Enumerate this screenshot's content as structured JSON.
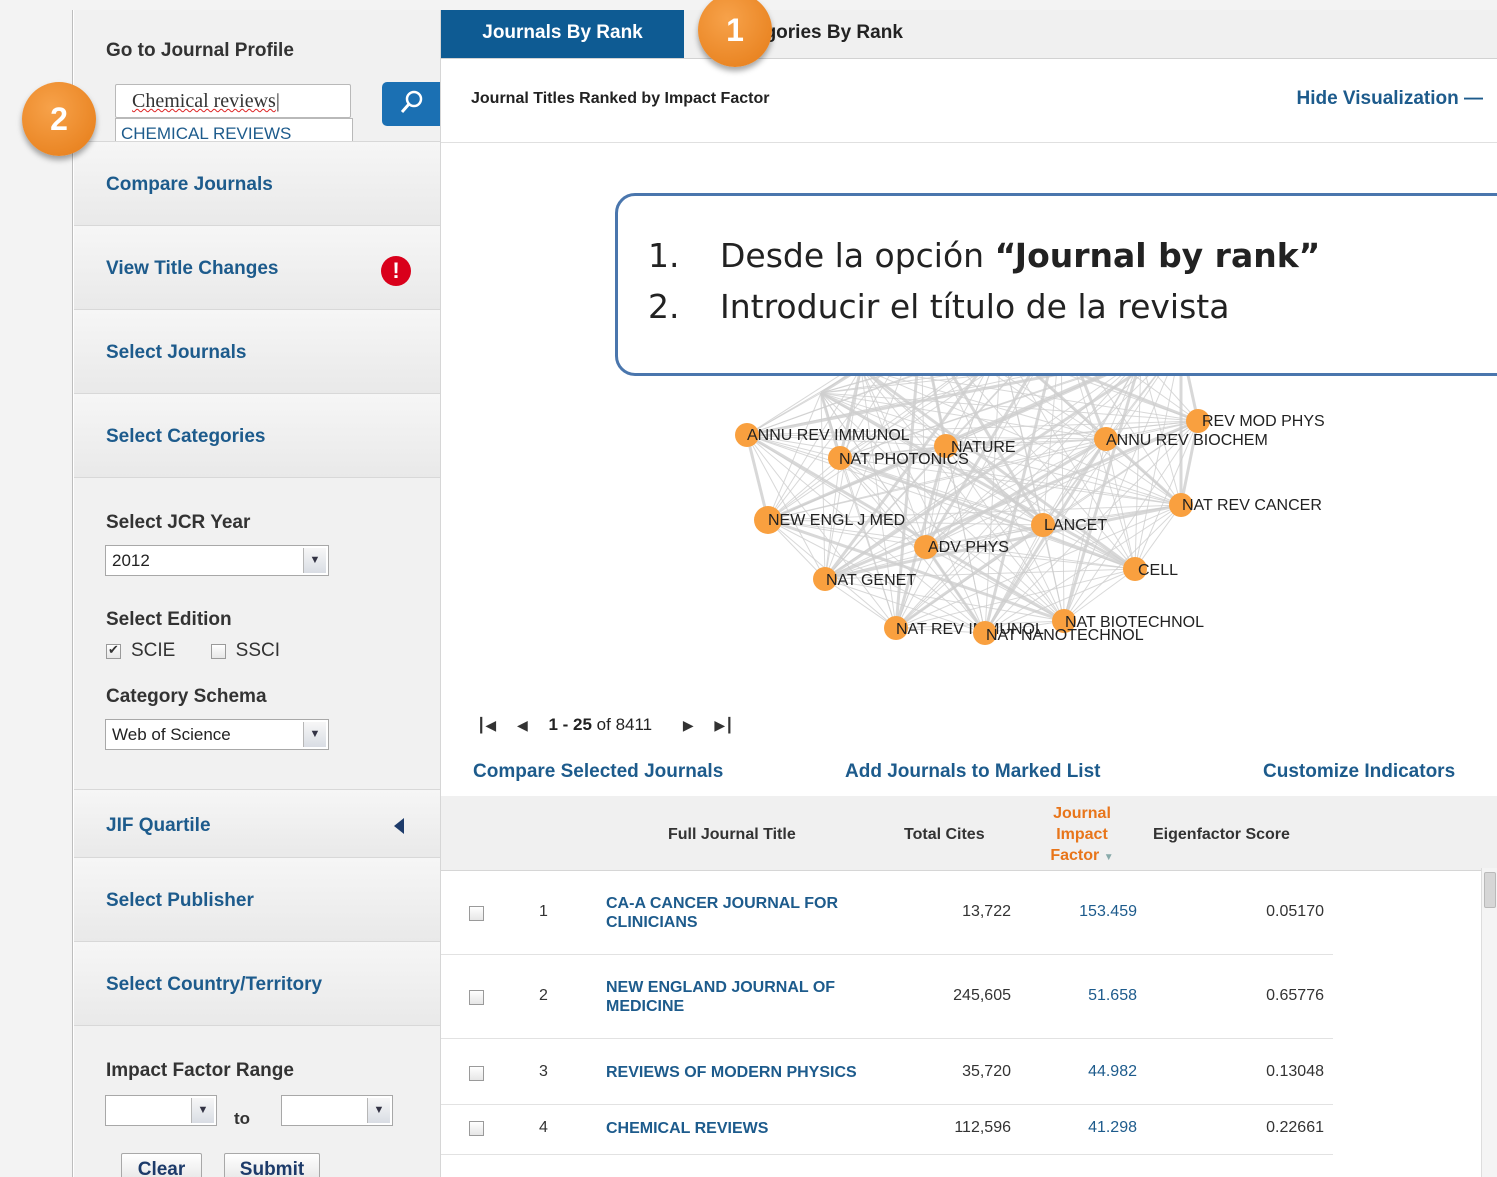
{
  "sidebar": {
    "goto_label": "Go to Journal Profile",
    "search_value": "Chemical reviews",
    "suggestion": "CHEMICAL REVIEWS",
    "compare_journals": "Compare Journals",
    "view_title_changes": "View Title Changes",
    "alert_glyph": "!",
    "select_journals": "Select Journals",
    "select_categories": "Select Categories",
    "jcr_year_label": "Select JCR Year",
    "jcr_year_value": "2012",
    "edition_label": "Select Edition",
    "edition_scie": "SCIE",
    "edition_ssci": "SSCI",
    "schema_label": "Category Schema",
    "schema_value": "Web of Science",
    "jif_quartile": "JIF Quartile",
    "select_publisher": "Select Publisher",
    "select_country": "Select Country/Territory",
    "if_range_label": "Impact Factor Range",
    "if_range_to": "to",
    "clear_button": "Clear",
    "submit_button": "Submit"
  },
  "tabs": {
    "active": "Journals By Rank",
    "other": "egories By Rank"
  },
  "header": {
    "vis_title": "Journal Titles Ranked by Impact Factor",
    "hide_visualization": "Hide Visualization"
  },
  "network_labels": [
    "REV MOD PHYS",
    "ANNU REV IMMUNOL",
    "NATURE",
    "ANNU REV BIOCHEM",
    "NAT PHOTONICS",
    "NAT REV CANCER",
    "NEW ENGL J MED",
    "LANCET",
    "ADV PHYS",
    "CELL",
    "NAT GENET",
    "NAT BIOTECHNOL",
    "NAT REV IMMUNOL",
    "NAT NANOTECHNOL"
  ],
  "pager": {
    "range": "1 - 25",
    "of_total": "of 8411"
  },
  "actions": {
    "compare_selected": "Compare Selected Journals",
    "add_marked": "Add Journals to Marked List",
    "customize": "Customize Indicators"
  },
  "table": {
    "headers": {
      "title": "Full Journal Title",
      "cites": "Total Cites",
      "jif_line1": "Journal",
      "jif_line2": "Impact",
      "jif_line3": "Factor",
      "eigen": "Eigenfactor Score"
    },
    "rows": [
      {
        "rank": "1",
        "title_line1": "CA-A CANCER JOURNAL FOR",
        "title_line2": "CLINICIANS",
        "cites": "13,722",
        "jif": "153.459",
        "eigen": "0.05170"
      },
      {
        "rank": "2",
        "title_line1": "NEW ENGLAND JOURNAL OF",
        "title_line2": "MEDICINE",
        "cites": "245,605",
        "jif": "51.658",
        "eigen": "0.65776"
      },
      {
        "rank": "3",
        "title_line1": "REVIEWS OF MODERN PHYSICS",
        "title_line2": "",
        "cites": "35,720",
        "jif": "44.982",
        "eigen": "0.13048"
      },
      {
        "rank": "4",
        "title_line1": "CHEMICAL REVIEWS",
        "title_line2": "",
        "cites": "112,596",
        "jif": "41.298",
        "eigen": "0.22661"
      }
    ]
  },
  "callout": {
    "n1": "1.",
    "item1_pre": "Desde la opción ",
    "item1_bold": "“Journal by rank”",
    "n2": "2.",
    "item2": "Introducir el título de la revista"
  },
  "badges": {
    "one": "1",
    "two": "2"
  },
  "colors": {
    "tab_active": "#0e5b93",
    "link": "#1d5b8c",
    "jif_header": "#e8751a",
    "node": "#f9a03f",
    "badge": "#e57b16"
  }
}
